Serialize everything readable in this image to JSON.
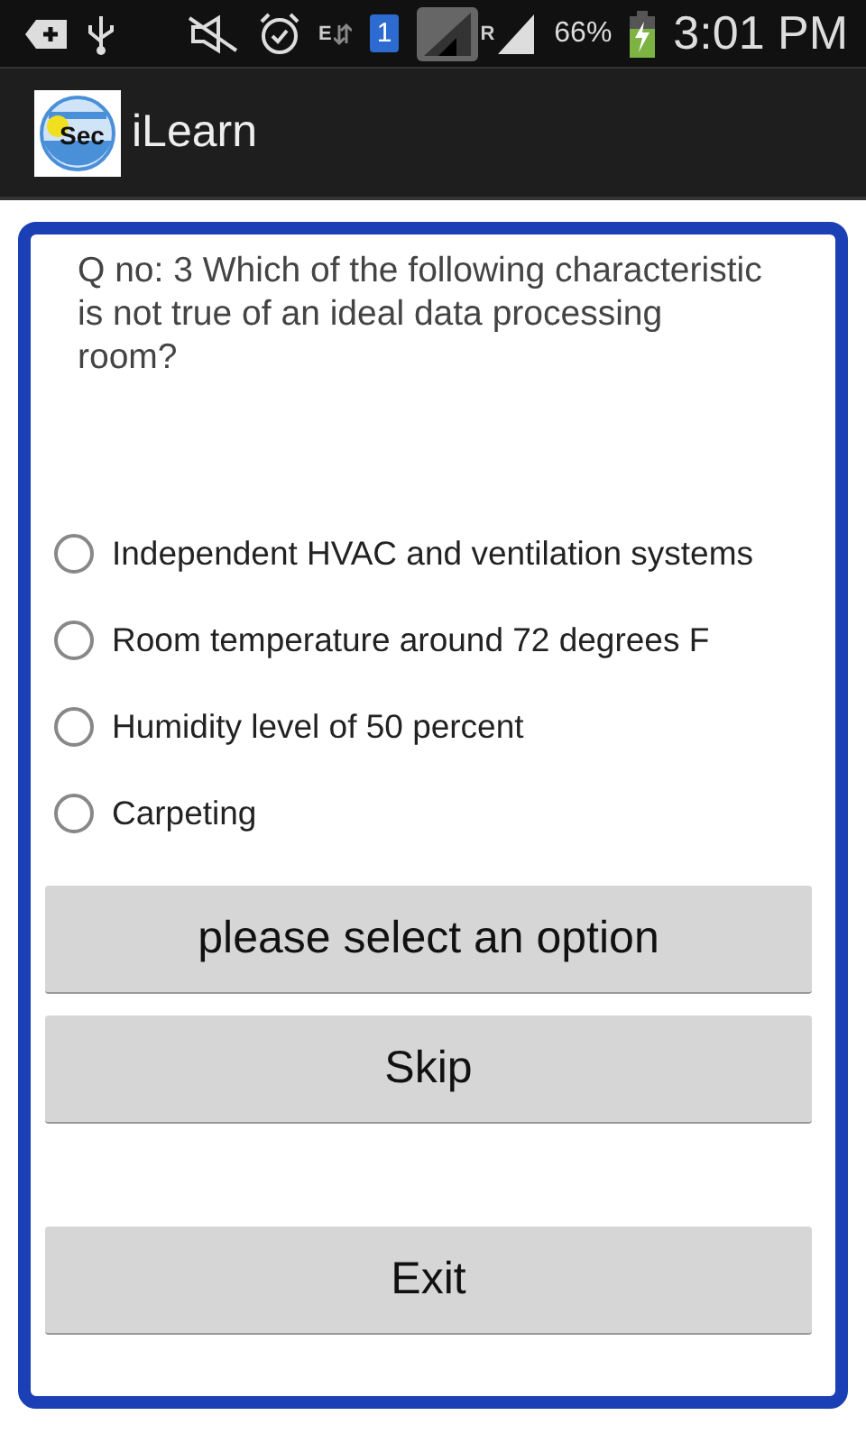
{
  "status_bar": {
    "network_type": "E",
    "sim_slot": "1",
    "roaming": "R",
    "battery": "66%",
    "time": "3:01 PM"
  },
  "action_bar": {
    "logo_text": "Sec",
    "title": "iLearn"
  },
  "question": "Q no: 3 Which of the following characteristic is not true of an ideal data processing room?",
  "options": [
    {
      "label": "Independent HVAC and ventilation systems",
      "selected": false
    },
    {
      "label": "Room temperature around 72 degrees F",
      "selected": false
    },
    {
      "label": "Humidity level of 50 percent",
      "selected": false
    },
    {
      "label": "Carpeting",
      "selected": false
    }
  ],
  "buttons": [
    {
      "label": "please select an option",
      "kind": "submit"
    },
    {
      "label": "Skip",
      "kind": "action"
    },
    {
      "label": "Exit",
      "kind": "exit"
    }
  ]
}
